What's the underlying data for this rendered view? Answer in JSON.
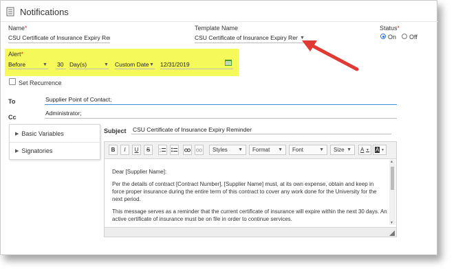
{
  "title": "Notifications",
  "name": {
    "label": "Name",
    "req": "*",
    "value": "CSU Certificate of Insurance Expiry Rer"
  },
  "template": {
    "label": "Template Name",
    "value": "CSU Certificate of Insurance Expiry Remin..."
  },
  "status": {
    "label": "Status",
    "req": "*",
    "on": "On",
    "off": "Off",
    "selected": "On"
  },
  "alert": {
    "label": "Alert",
    "req": "*",
    "when": "Before",
    "count": "30",
    "unit": "Day(s)",
    "date_type": "Custom Date",
    "date": "12/31/2019"
  },
  "recurrence": {
    "label": "Set Recurrence"
  },
  "to": {
    "label": "To",
    "value": "Supplier Point of Contact;"
  },
  "cc": {
    "label": "Cc",
    "value": "Administrator;"
  },
  "sidebar": {
    "items": [
      {
        "label": "Basic Variables"
      },
      {
        "label": "Signatories"
      }
    ]
  },
  "subject": {
    "label": "Subject",
    "value": "CSU Certificate of Insurance Expiry Reminder"
  },
  "toolbar": {
    "bold": "B",
    "italic": "I",
    "underline": "U",
    "strike": "S",
    "styles": "Styles",
    "format": "Format",
    "font": "Font",
    "size": "Size",
    "text_color": "A",
    "bg_color": "A"
  },
  "body": {
    "greeting": "Dear [Supplier Name]:",
    "p1": "Per the details of contract [Contract Number], [Supplier Name] must, at its own expense, obtain and keep in force proper insurance during the entire term of this contract to cover any work done for the University for the next period.",
    "p2": "This message serves as a reminder that the current certificate of insurance will expire within the next 30 days. An active certificate of insurance must be on file in order to continue services."
  },
  "colors": {
    "highlight": "#f6f95a",
    "arrow": "#e03a36",
    "required": "#d9302c",
    "radio": "#2a6fd6",
    "calendar": "#4a9a2a"
  }
}
